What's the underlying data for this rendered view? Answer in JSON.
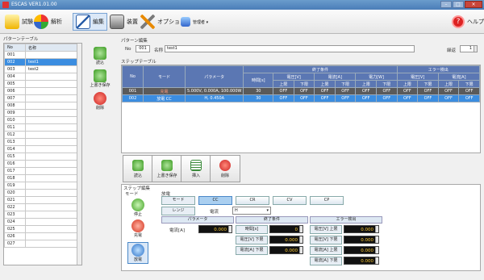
{
  "window": {
    "title": "ESCAS VER1.01.00",
    "min_label": "–",
    "max_label": "□",
    "close_label": "×"
  },
  "toolbar": {
    "test": "試験",
    "analysis": "解析",
    "edit": "編集",
    "device": "装置",
    "options": "オプション",
    "admin": "管理者 ▾",
    "help": "ヘルプ"
  },
  "pattern_table": {
    "title": "パターンテーブル",
    "col_no": "No",
    "col_name": "名称",
    "rows": [
      {
        "no": "001",
        "name": ""
      },
      {
        "no": "002",
        "name": "test1"
      },
      {
        "no": "003",
        "name": "test2"
      },
      {
        "no": "004",
        "name": ""
      },
      {
        "no": "005",
        "name": ""
      },
      {
        "no": "006",
        "name": ""
      },
      {
        "no": "007",
        "name": ""
      },
      {
        "no": "008",
        "name": ""
      },
      {
        "no": "009",
        "name": ""
      },
      {
        "no": "010",
        "name": ""
      },
      {
        "no": "011",
        "name": ""
      },
      {
        "no": "012",
        "name": ""
      },
      {
        "no": "013",
        "name": ""
      },
      {
        "no": "014",
        "name": ""
      },
      {
        "no": "015",
        "name": ""
      },
      {
        "no": "016",
        "name": ""
      },
      {
        "no": "017",
        "name": ""
      },
      {
        "no": "018",
        "name": ""
      },
      {
        "no": "019",
        "name": ""
      },
      {
        "no": "020",
        "name": ""
      },
      {
        "no": "021",
        "name": ""
      },
      {
        "no": "022",
        "name": ""
      },
      {
        "no": "023",
        "name": ""
      },
      {
        "no": "024",
        "name": ""
      },
      {
        "no": "025",
        "name": ""
      },
      {
        "no": "026",
        "name": ""
      },
      {
        "no": "027",
        "name": ""
      }
    ],
    "selected_row": 1
  },
  "side_buttons": {
    "load": "読込",
    "overwrite": "上書き保存",
    "delete": "削除"
  },
  "pattern_edit": {
    "title": "パターン編集",
    "no_label": "No",
    "no_value": "001",
    "name_label": "名称",
    "name_value": "test1",
    "repeat_label": "繰返",
    "repeat_value": "1"
  },
  "step_table": {
    "title": "ステップテーブル",
    "headers": {
      "no": "No",
      "mode": "モード",
      "param": "パラメータ",
      "end_cond": "終了条件",
      "error_detect": "エラー検出",
      "time": "時間[s]",
      "voltage": "電圧[V]",
      "current": "電流[A]",
      "power": "電力[W]",
      "upper": "上限",
      "lower": "下限"
    },
    "rows": [
      {
        "no": "001",
        "mode": "充電",
        "param": "5.000V, 0.000A, 100.000W",
        "time": "30",
        "cells": [
          "OFF",
          "OFF",
          "OFF",
          "OFF",
          "OFF",
          "OFF",
          "OFF",
          "OFF",
          "OFF",
          "OFF"
        ]
      },
      {
        "no": "002",
        "mode": "放電 CC",
        "param": "H, 0.450A",
        "time": "30",
        "cells": [
          "OFF",
          "OFF",
          "OFF",
          "OFF",
          "OFF",
          "OFF",
          "OFF",
          "OFF",
          "OFF",
          "OFF"
        ]
      }
    ]
  },
  "step_buttons": {
    "load": "読込",
    "overwrite": "上書き保存",
    "insert": "挿入",
    "delete": "削除"
  },
  "step_edit": {
    "title": "ステップ編集",
    "mode_label": "モード",
    "stop": "停止",
    "charge": "充電",
    "discharge": "放電",
    "discharge_title": "放電",
    "mode_row_label": "モード",
    "modes": [
      "CC",
      "CR",
      "CV",
      "CP"
    ],
    "range_label": "レンジ",
    "current_label": "電流",
    "range_value": "H",
    "param_header": "パラメータ",
    "end_header": "終了条件",
    "error_header": "エラー検出",
    "param_current_label": "電流[A]",
    "param_current_value": "0.000",
    "end_time_label": "時間[s]",
    "end_time_value": "0",
    "end_v_lower_label": "電圧[V] 下限",
    "end_v_lower_value": "0.000",
    "end_a_lower_label": "電流[A] 下限",
    "end_a_lower_value": "0.000",
    "err_v_upper_label": "電圧[V] 上限",
    "err_v_upper_value": "0.000",
    "err_v_lower_label": "電圧[V] 下限",
    "err_v_lower_value": "0.000",
    "err_a_upper_label": "電流[A] 上限",
    "err_a_upper_value": "0.000",
    "err_a_lower_label": "電流[A] 下限",
    "err_a_lower_value": "0.000"
  }
}
